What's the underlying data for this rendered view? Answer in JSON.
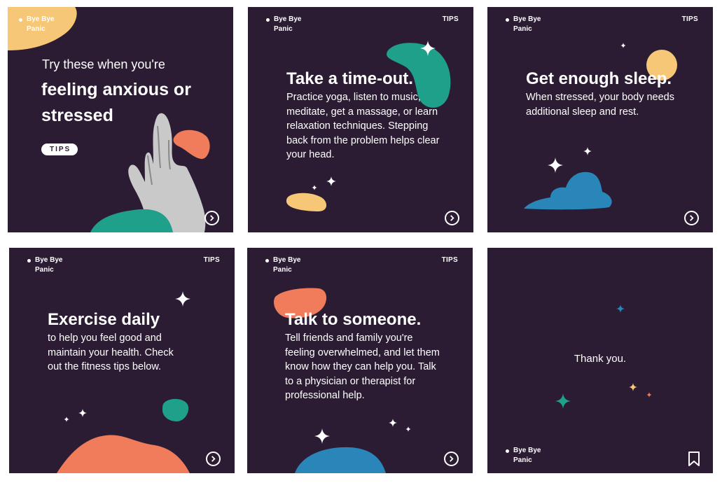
{
  "brand": {
    "name": "Bye Bye Panic"
  },
  "tag": "TIPS",
  "colors": {
    "bg": "#2b1c33",
    "teal": "#1fa08a",
    "orange": "#f07c5b",
    "yellow": "#f6c776",
    "blue": "#2a86b9"
  },
  "icons": {
    "next": "chevron-circle-icon",
    "save": "bookmark-icon",
    "sparkle": "sparkle-icon"
  },
  "slides": [
    {
      "intro": "Try these when you're",
      "title": "feeling anxious or stressed",
      "pill": "TIPS"
    },
    {
      "title": "Take a time-out.",
      "body": "Practice yoga, listen to music, meditate, get a massage, or learn relaxation techniques. Stepping back from the problem helps clear your head."
    },
    {
      "title": "Get enough sleep.",
      "body": "When stressed, your body needs additional sleep and rest."
    },
    {
      "title": "Exercise daily",
      "body": "to help you feel good and maintain your health. Check out the fitness tips below."
    },
    {
      "title": "Talk to someone.",
      "body": "Tell friends and family you're feeling overwhelmed, and let them know how they can help you. Talk to a physician or therapist for professional help."
    },
    {
      "body": "Thank you."
    }
  ]
}
